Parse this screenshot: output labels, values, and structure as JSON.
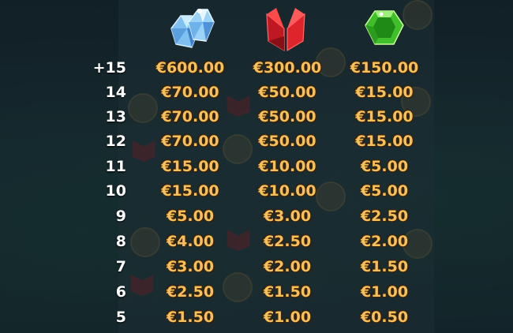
{
  "symbols": [
    {
      "icon": "blue-diamond-icon"
    },
    {
      "icon": "red-ruby-icon"
    },
    {
      "icon": "green-emerald-icon"
    }
  ],
  "colors": {
    "prize": "#f6c05a",
    "count": "#ffffff"
  },
  "paytable": [
    {
      "count": "+15",
      "prizes": [
        "€600.00",
        "€300.00",
        "€150.00"
      ]
    },
    {
      "count": "14",
      "prizes": [
        "€70.00",
        "€50.00",
        "€15.00"
      ]
    },
    {
      "count": "13",
      "prizes": [
        "€70.00",
        "€50.00",
        "€15.00"
      ]
    },
    {
      "count": "12",
      "prizes": [
        "€70.00",
        "€50.00",
        "€15.00"
      ]
    },
    {
      "count": "11",
      "prizes": [
        "€15.00",
        "€10.00",
        "€5.00"
      ]
    },
    {
      "count": "10",
      "prizes": [
        "€15.00",
        "€10.00",
        "€5.00"
      ]
    },
    {
      "count": "9",
      "prizes": [
        "€5.00",
        "€3.00",
        "€2.50"
      ]
    },
    {
      "count": "8",
      "prizes": [
        "€4.00",
        "€2.50",
        "€2.00"
      ]
    },
    {
      "count": "7",
      "prizes": [
        "€3.00",
        "€2.00",
        "€1.50"
      ]
    },
    {
      "count": "6",
      "prizes": [
        "€2.50",
        "€1.50",
        "€1.00"
      ]
    },
    {
      "count": "5",
      "prizes": [
        "€1.50",
        "€1.00",
        "€0.50"
      ]
    }
  ]
}
